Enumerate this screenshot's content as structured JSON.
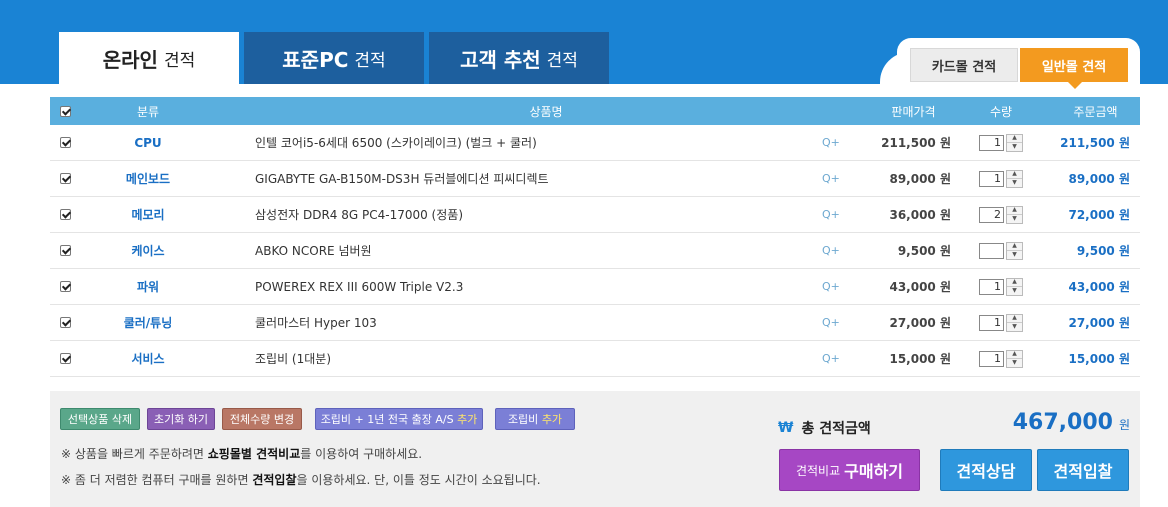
{
  "tabs": [
    {
      "main": "온라인",
      "sub": "견적"
    },
    {
      "main": "표준PC",
      "sub": "견적"
    },
    {
      "main": "고객 추천",
      "sub": "견적"
    }
  ],
  "segments": {
    "card": "카드몰 견적",
    "general": "일반몰 견적"
  },
  "table": {
    "headers": {
      "category": "분류",
      "product": "상품명",
      "price": "판매가격",
      "qty": "수량",
      "total": "주문금액"
    },
    "rows": [
      {
        "category": "CPU",
        "name": "인텔 코어i5-6세대 6500 (스카이레이크) (벌크 + 쿨러)",
        "price": "211,500 원",
        "qty": "1",
        "total": "211,500 원"
      },
      {
        "category": "메인보드",
        "name": "GIGABYTE GA-B150M-DS3H 듀러블에디션 피씨디렉트",
        "price": "89,000 원",
        "qty": "1",
        "total": "89,000 원"
      },
      {
        "category": "메모리",
        "name": "삼성전자 DDR4 8G PC4-17000 (정품)",
        "price": "36,000 원",
        "qty": "2",
        "total": "72,000 원"
      },
      {
        "category": "케이스",
        "name": "ABKO NCORE 넘버원",
        "price": "9,500 원",
        "qty": "",
        "total": "9,500 원"
      },
      {
        "category": "파워",
        "name": "POWEREX REX III 600W Triple V2.3",
        "price": "43,000 원",
        "qty": "1",
        "total": "43,000 원"
      },
      {
        "category": "쿨러/튜닝",
        "name": "쿨러마스터 Hyper 103",
        "price": "27,000 원",
        "qty": "1",
        "total": "27,000 원"
      },
      {
        "category": "서비스",
        "name": "조립비 (1대분)",
        "price": "15,000 원",
        "qty": "1",
        "total": "15,000 원"
      }
    ]
  },
  "actions": {
    "delete": "선택상품 삭제",
    "reset": "초기화 하기",
    "change_qty": "전체수량 변경",
    "assembly_as_main": "조립비 + 1년 전국 출장 A/S",
    "assembly_as_add": "추가",
    "assembly_main": "조립비",
    "assembly_add": "추가"
  },
  "notes": {
    "note1_pre": "※ 상품을 빠르게 주문하려면 ",
    "note1_bold": "쇼핑몰별 견적비교",
    "note1_post": "를 이용하여 구매하세요.",
    "note2_pre": "※ 좀 더 저렴한 컴퓨터 구매를 원하면 ",
    "note2_bold": "견적입찰",
    "note2_post": "을 이용하세요. 단, 이틀 정도 시간이 소요됩니다."
  },
  "summary": {
    "won_symbol": "₩",
    "label": "총 견적금액",
    "value": "467,000",
    "unit": "원"
  },
  "buttons": {
    "compare_small": "견적비교",
    "compare_main": "구매하기",
    "consult": "견적상담",
    "bid": "견적입찰"
  },
  "icons": {
    "zoom": "Q+"
  },
  "colors": {
    "header": "#1a83d4",
    "accent_orange": "#f39a1f",
    "table_head": "#5aafde",
    "price_blue": "#1a6fc4"
  }
}
